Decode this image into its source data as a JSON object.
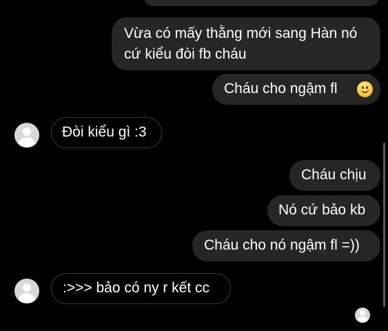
{
  "conversation": {
    "messages": [
      {
        "sender": "me",
        "lines": [
          "Vừa có mấy thằng mới sang Hàn nó",
          "cứ kiểu đòi fb cháu"
        ]
      },
      {
        "sender": "me",
        "text": "Cháu cho ngậm fl",
        "emoji": "slightly-smiling-face-icon"
      },
      {
        "sender": "other",
        "text": "Đòi kiểu gì :3"
      },
      {
        "sender": "me",
        "text": "Cháu chịu"
      },
      {
        "sender": "me",
        "text": "Nó cứ bảo kb"
      },
      {
        "sender": "me",
        "text": "Cháu cho nó ngậm fl =))"
      },
      {
        "sender": "other",
        "text": ":>>> bảo có ny r kết cc"
      }
    ]
  },
  "colors": {
    "background": "#000000",
    "outgoing_bubble": "#262626",
    "incoming_border": "#3a3a3a",
    "text": "#ffffff",
    "avatar_placeholder": "#d8d8d8"
  },
  "icons": {
    "contact_avatar": "default-avatar-icon",
    "seen_indicator": "seen-avatar-icon",
    "emoji": "slightly-smiling-face-icon"
  }
}
